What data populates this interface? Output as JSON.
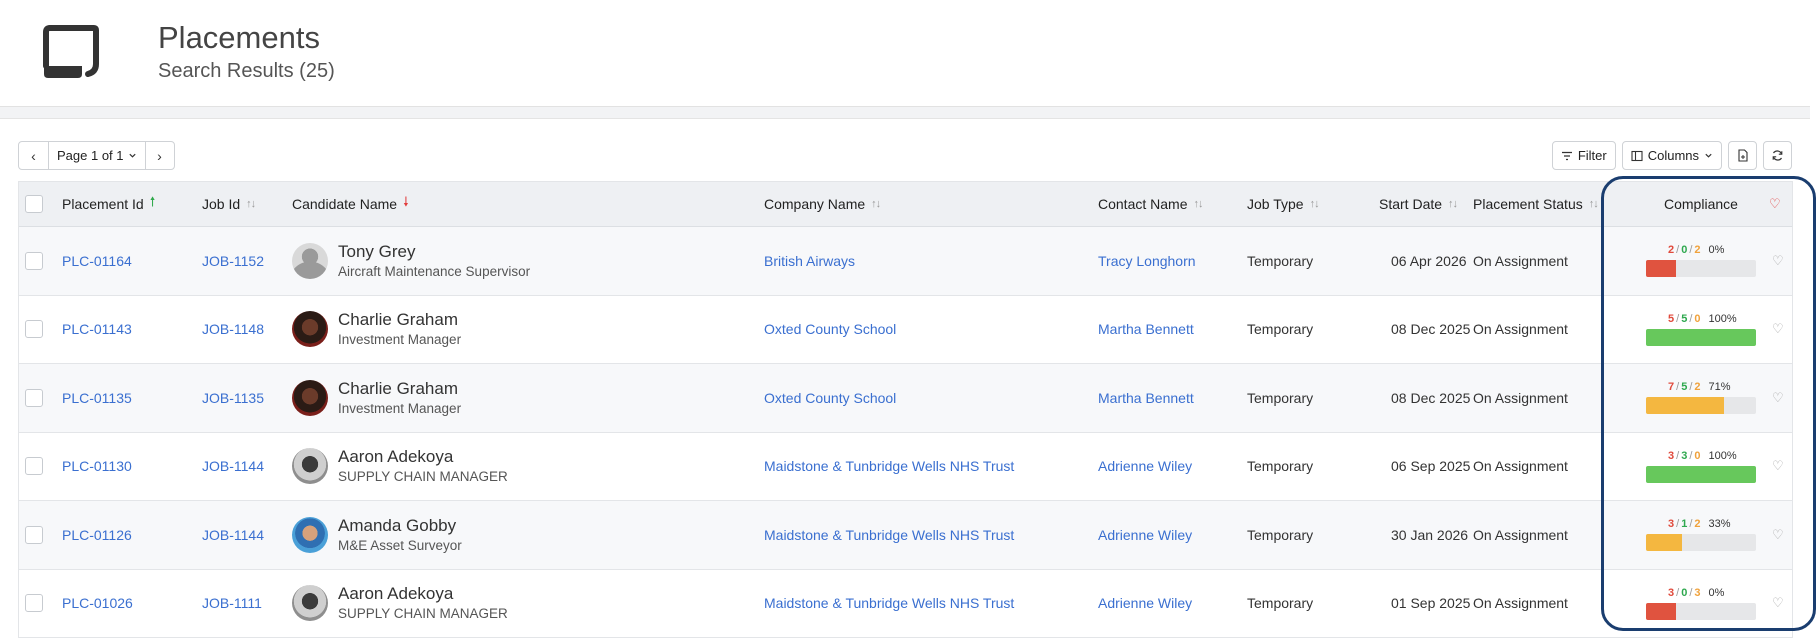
{
  "header": {
    "title": "Placements",
    "subtitle": "Search Results (25)",
    "icon": "scroll-document-icon"
  },
  "pager": {
    "prev_icon": "chevron-left-icon",
    "label": "Page 1 of 1",
    "dropdown_icon": "chevron-down-icon",
    "next_icon": "chevron-right-icon"
  },
  "toolbar": {
    "filter_label": "Filter",
    "columns_label": "Columns",
    "export_icon": "export-document-icon",
    "refresh_icon": "refresh-icon"
  },
  "table": {
    "headers": {
      "placement_id": "Placement Id",
      "job_id": "Job Id",
      "candidate_name": "Candidate Name",
      "company_name": "Company Name",
      "contact_name": "Contact Name",
      "job_type": "Job Type",
      "start_date": "Start Date",
      "placement_status": "Placement Status",
      "compliance": "Compliance"
    },
    "rows": [
      {
        "placement_id": "PLC-01164",
        "job_id": "JOB-1152",
        "candidate_name": "Tony Grey",
        "candidate_role": "Aircraft Maintenance Supervisor",
        "company_name": "British Airways",
        "contact_name": "Tracy Longhorn",
        "job_type": "Temporary",
        "start_date": "06 Apr 2026",
        "placement_status": "On Assignment",
        "compliance": {
          "red": "2",
          "green": "0",
          "orange": "2",
          "percent_label": "0%",
          "fill_fraction": 0.27,
          "bar_color": "#e0533f"
        }
      },
      {
        "placement_id": "PLC-01143",
        "job_id": "JOB-1148",
        "candidate_name": "Charlie Graham",
        "candidate_role": "Investment Manager",
        "company_name": "Oxted County School",
        "contact_name": "Martha Bennett",
        "job_type": "Temporary",
        "start_date": "08 Dec 2025",
        "placement_status": "On Assignment",
        "compliance": {
          "red": "5",
          "green": "5",
          "orange": "0",
          "percent_label": "100%",
          "fill_fraction": 1.0,
          "bar_color": "#67c85c"
        }
      },
      {
        "placement_id": "PLC-01135",
        "job_id": "JOB-1135",
        "candidate_name": "Charlie Graham",
        "candidate_role": "Investment Manager",
        "company_name": "Oxted County School",
        "contact_name": "Martha Bennett",
        "job_type": "Temporary",
        "start_date": "08 Dec 2025",
        "placement_status": "On Assignment",
        "compliance": {
          "red": "7",
          "green": "5",
          "orange": "2",
          "percent_label": "71%",
          "fill_fraction": 0.71,
          "bar_color": "#f4b740"
        }
      },
      {
        "placement_id": "PLC-01130",
        "job_id": "JOB-1144",
        "candidate_name": "Aaron Adekoya",
        "candidate_role": "SUPPLY CHAIN MANAGER",
        "company_name": "Maidstone & Tunbridge Wells NHS Trust",
        "contact_name": "Adrienne Wiley",
        "job_type": "Temporary",
        "start_date": "06 Sep 2025",
        "placement_status": "On Assignment",
        "compliance": {
          "red": "3",
          "green": "3",
          "orange": "0",
          "percent_label": "100%",
          "fill_fraction": 1.0,
          "bar_color": "#67c85c"
        }
      },
      {
        "placement_id": "PLC-01126",
        "job_id": "JOB-1144",
        "candidate_name": "Amanda Gobby",
        "candidate_role": "M&E Asset Surveyor",
        "company_name": "Maidstone & Tunbridge Wells NHS Trust",
        "contact_name": "Adrienne Wiley",
        "job_type": "Temporary",
        "start_date": "30 Jan 2026",
        "placement_status": "On Assignment",
        "compliance": {
          "red": "3",
          "green": "1",
          "orange": "2",
          "percent_label": "33%",
          "fill_fraction": 0.33,
          "bar_color": "#f4b740"
        }
      },
      {
        "placement_id": "PLC-01026",
        "job_id": "JOB-1111",
        "candidate_name": "Aaron Adekoya",
        "candidate_role": "SUPPLY CHAIN MANAGER",
        "company_name": "Maidstone & Tunbridge Wells NHS Trust",
        "contact_name": "Adrienne Wiley",
        "job_type": "Temporary",
        "start_date": "01 Sep 2025",
        "placement_status": "On Assignment",
        "compliance": {
          "red": "3",
          "green": "0",
          "orange": "3",
          "percent_label": "0%",
          "fill_fraction": 0.27,
          "bar_color": "#e0533f"
        }
      }
    ]
  },
  "colors": {
    "link": "#3a6fd0",
    "highlight_border": "#1a3d6f",
    "sort_asc": "#2ea84a",
    "sort_desc": "#e23c3c"
  }
}
